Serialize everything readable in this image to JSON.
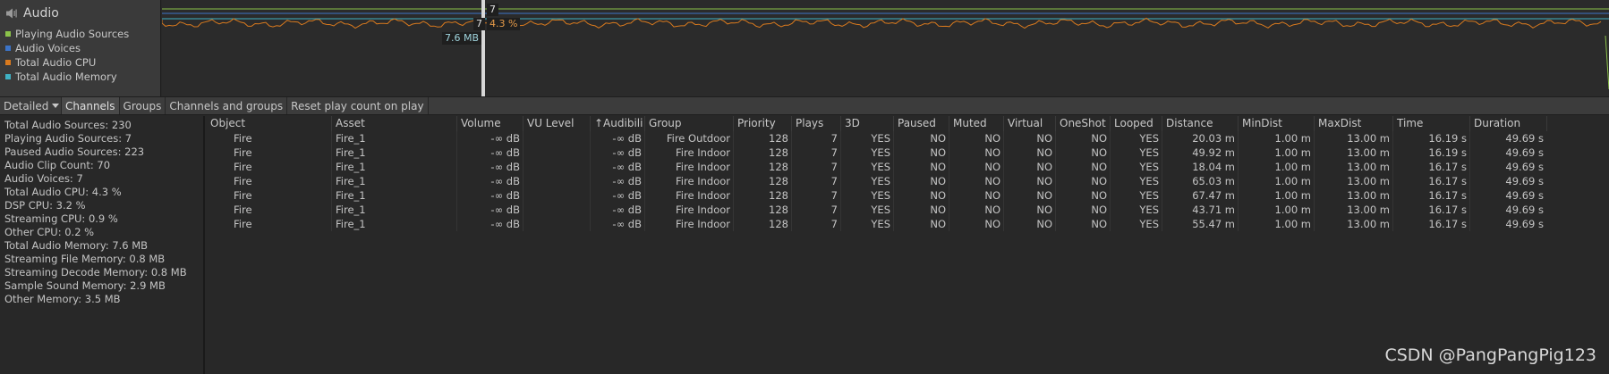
{
  "module": {
    "title": "Audio",
    "icon": "speaker-icon",
    "legend": [
      {
        "label": "Playing Audio Sources",
        "color": "#8bc34a"
      },
      {
        "label": "Audio Voices",
        "color": "#3c74c8"
      },
      {
        "label": "Total Audio CPU",
        "color": "#d97a1e"
      },
      {
        "label": "Total Audio Memory",
        "color": "#3fb1c3"
      }
    ]
  },
  "graph": {
    "labels": {
      "playing_sources": "7",
      "voices": "7",
      "cpu": "4.3 %",
      "memory": "7.6 MB"
    }
  },
  "toolbar": {
    "mode": "Detailed",
    "tabs": [
      "Channels",
      "Groups",
      "Channels and groups"
    ],
    "active_tab": "Channels",
    "reset_label": "Reset play count on play"
  },
  "stats": [
    "Total Audio Sources: 230",
    "Playing Audio Sources: 7",
    "Paused Audio Sources: 223",
    "Audio Clip Count: 70",
    "Audio Voices: 7",
    "Total Audio CPU: 4.3 %",
    "DSP CPU: 3.2 %",
    "Streaming CPU: 0.9 %",
    "Other CPU: 0.2 %",
    "Total Audio Memory: 7.6 MB",
    "Streaming File Memory: 0.8 MB",
    "Streaming Decode Memory: 0.8 MB",
    "Sample Sound Memory: 2.9 MB",
    "Other Memory: 3.5 MB"
  ],
  "table": {
    "columns": [
      "Object",
      "Asset",
      "Volume",
      "VU Level",
      "↑Audibili",
      "Group",
      "Priority",
      "Plays",
      "3D",
      "Paused",
      "Muted",
      "Virtual",
      "OneShot",
      "Looped",
      "Distance",
      "MinDist",
      "MaxDist",
      "Time",
      "Duration"
    ],
    "rows": [
      [
        "Fire",
        "Fire_1",
        "-∞ dB",
        "",
        "-∞ dB",
        "Fire Outdoor",
        "128",
        "7",
        "YES",
        "NO",
        "NO",
        "NO",
        "NO",
        "YES",
        "20.03 m",
        "1.00 m",
        "13.00 m",
        "16.19 s",
        "49.69 s"
      ],
      [
        "Fire",
        "Fire_1",
        "-∞ dB",
        "",
        "-∞ dB",
        "Fire Indoor",
        "128",
        "7",
        "YES",
        "NO",
        "NO",
        "NO",
        "NO",
        "YES",
        "49.92 m",
        "1.00 m",
        "13.00 m",
        "16.19 s",
        "49.69 s"
      ],
      [
        "Fire",
        "Fire_1",
        "-∞ dB",
        "",
        "-∞ dB",
        "Fire Indoor",
        "128",
        "7",
        "YES",
        "NO",
        "NO",
        "NO",
        "NO",
        "YES",
        "18.04 m",
        "1.00 m",
        "13.00 m",
        "16.17 s",
        "49.69 s"
      ],
      [
        "Fire",
        "Fire_1",
        "-∞ dB",
        "",
        "-∞ dB",
        "Fire Indoor",
        "128",
        "7",
        "YES",
        "NO",
        "NO",
        "NO",
        "NO",
        "YES",
        "65.03 m",
        "1.00 m",
        "13.00 m",
        "16.17 s",
        "49.69 s"
      ],
      [
        "Fire",
        "Fire_1",
        "-∞ dB",
        "",
        "-∞ dB",
        "Fire Indoor",
        "128",
        "7",
        "YES",
        "NO",
        "NO",
        "NO",
        "NO",
        "YES",
        "67.47 m",
        "1.00 m",
        "13.00 m",
        "16.17 s",
        "49.69 s"
      ],
      [
        "Fire",
        "Fire_1",
        "-∞ dB",
        "",
        "-∞ dB",
        "Fire Indoor",
        "128",
        "7",
        "YES",
        "NO",
        "NO",
        "NO",
        "NO",
        "YES",
        "43.71 m",
        "1.00 m",
        "13.00 m",
        "16.17 s",
        "49.69 s"
      ],
      [
        "Fire",
        "Fire_1",
        "-∞ dB",
        "",
        "-∞ dB",
        "Fire Indoor",
        "128",
        "7",
        "YES",
        "NO",
        "NO",
        "NO",
        "NO",
        "YES",
        "55.47 m",
        "1.00 m",
        "13.00 m",
        "16.17 s",
        "49.69 s"
      ]
    ]
  },
  "watermark": "CSDN @PangPangPig123"
}
